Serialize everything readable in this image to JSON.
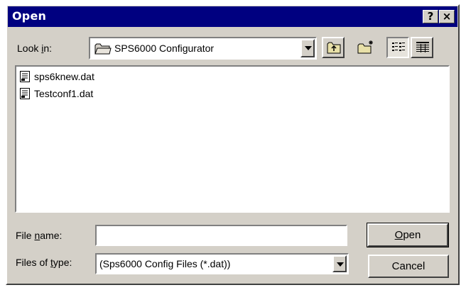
{
  "window": {
    "title": "Open",
    "help_label": "?",
    "close_label": "×"
  },
  "look_in": {
    "label_pre": "Look ",
    "label_accel": "i",
    "label_post": "n:",
    "value": "SPS6000 Configurator",
    "icon": "folder-icon"
  },
  "toolbar": {
    "up_folder_icon": "up-one-level-icon",
    "new_folder_icon": "create-new-folder-icon",
    "list_view_icon": "list-view-icon",
    "details_view_icon": "details-view-icon"
  },
  "files": [
    {
      "name": "sps6knew.dat",
      "icon": "document-icon"
    },
    {
      "name": "Testconf1.dat",
      "icon": "document-icon"
    }
  ],
  "file_name": {
    "label_pre": "File ",
    "label_accel": "n",
    "label_post": "ame:",
    "value": ""
  },
  "file_type": {
    "label_pre": "Files of ",
    "label_accel": "t",
    "label_post": "ype:",
    "value": "(Sps6000 Config Files (*.dat))"
  },
  "buttons": {
    "open_accel": "O",
    "open_rest": "pen",
    "cancel": "Cancel"
  },
  "colors": {
    "title_bar": "#000080",
    "dialog_face": "#d4d0c8"
  }
}
